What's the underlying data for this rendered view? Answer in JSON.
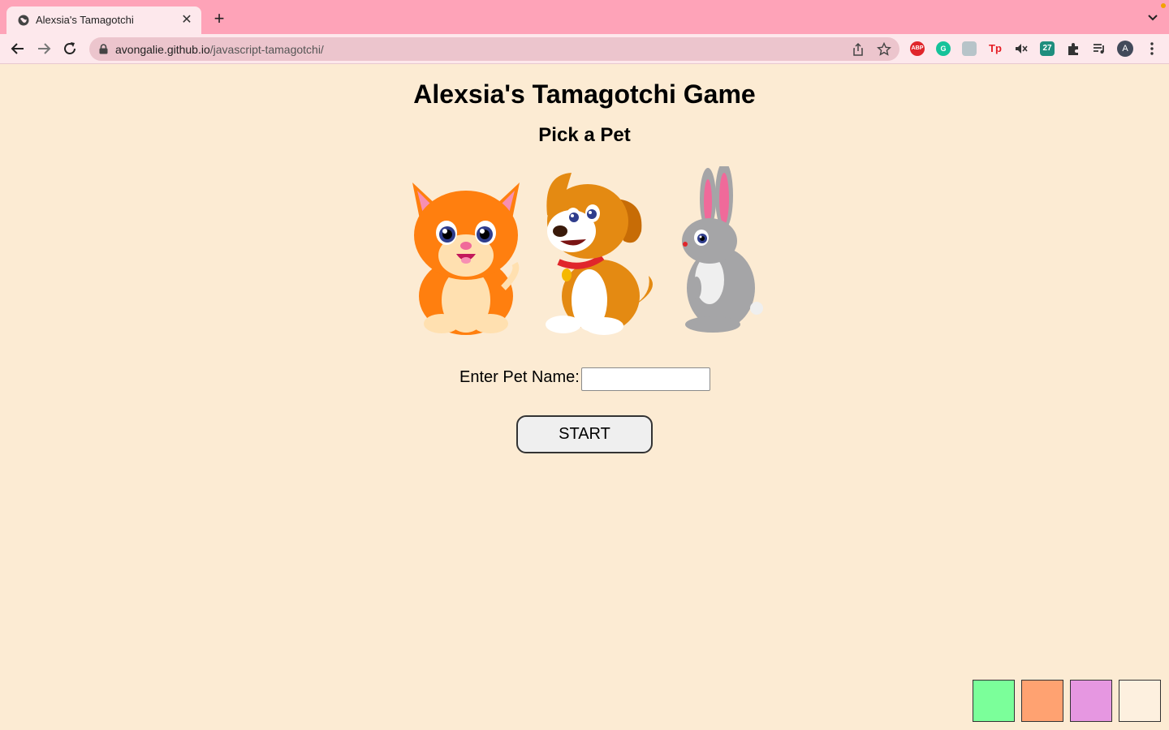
{
  "browser": {
    "tab_title": "Alexsia's Tamagotchi",
    "url_host": "avongalie.github.io",
    "url_path": "/javascript-tamagotchi/",
    "profile_initial": "A",
    "extensions": [
      {
        "name": "adblock-icon",
        "text": "ABP",
        "color": "#e0262b"
      },
      {
        "name": "grammarly-icon",
        "text": "G",
        "color": "#15c39a"
      },
      {
        "name": "toolkit-icon",
        "text": "",
        "color": "#b7c4c9"
      },
      {
        "name": "tp-icon",
        "text": "Tp",
        "color": "#e51c23"
      },
      {
        "name": "mute-icon",
        "text": "",
        "color": "#333333"
      },
      {
        "name": "calendar-icon",
        "text": "27",
        "color": "#1e8e7e"
      }
    ]
  },
  "page": {
    "title": "Alexsia's Tamagotchi Game",
    "subtitle": "Pick a Pet",
    "pets": [
      {
        "name": "cat",
        "color": "#ff7f0f"
      },
      {
        "name": "dog",
        "color": "#e48a12"
      },
      {
        "name": "bunny",
        "color": "#a5a5a7"
      }
    ],
    "name_label": "Enter Pet Name:",
    "name_value": "",
    "start_label": "START"
  },
  "theme_swatches": [
    "#7bff9a",
    "#ffa271",
    "#e697e1",
    "#fdf0df"
  ]
}
